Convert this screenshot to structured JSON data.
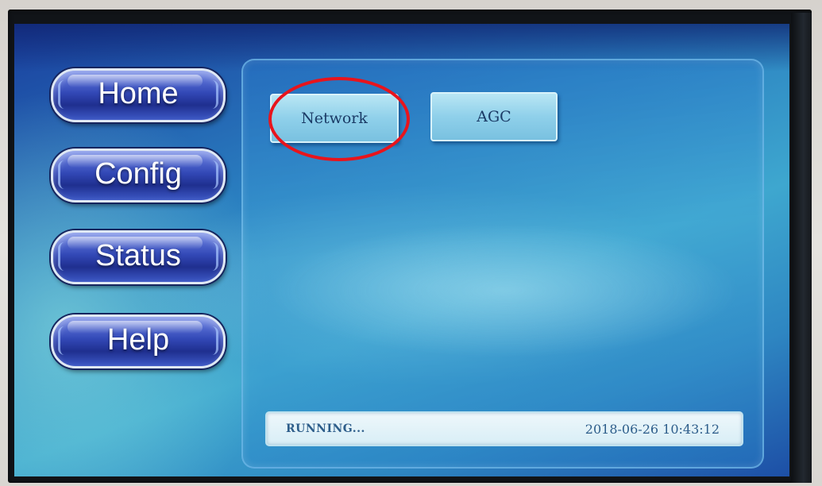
{
  "nav": {
    "home_label": "Home",
    "config_label": "Config",
    "status_label": "Status",
    "help_label": "Help"
  },
  "config_menu": {
    "network_label": "Network",
    "agc_label": "AGC"
  },
  "status_bar": {
    "status_text": "RUNNING...",
    "datetime": "2018-06-26 10:43:12"
  },
  "colors": {
    "highlight_ring": "#e8141c",
    "nav_button": "#3248b6",
    "screen_background": "#2a7fc0"
  }
}
